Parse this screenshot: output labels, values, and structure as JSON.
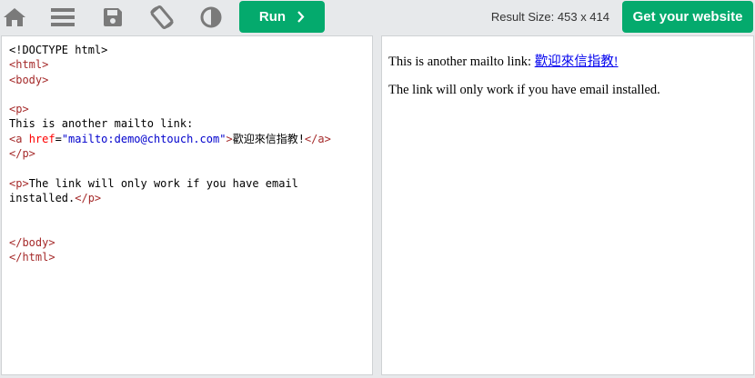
{
  "toolbar": {
    "icons": [
      "home-icon",
      "menu-icon",
      "save-icon",
      "rotate-icon",
      "theme-contrast-icon"
    ],
    "run_label": "Run",
    "result_size_label": "Result Size:",
    "result_size_value": "453 x 414",
    "get_website_label": "Get your website"
  },
  "code": {
    "line_doctype": "<!DOCTYPE html>",
    "line_html_open": "<html>",
    "line_body_open": "<body>",
    "line_p_open": "<p>",
    "line_text": "This is another mailto link:",
    "line_a_open_start": "<a ",
    "line_a_attr": "href",
    "line_a_eq": "=",
    "line_a_attrval": "\"mailto:demo@chtouch.com\"",
    "line_a_gt": ">",
    "line_a_text": "歡迎來信指教!",
    "line_a_close": "</a>",
    "line_p_close": "</p>",
    "line2_p_open": "<p>",
    "line2_text_1": "The link will only work if you have email",
    "line2_text_2": "installed.",
    "line2_p_close": "</p>",
    "line_body_close": "</body>",
    "line_html_close": "</html>"
  },
  "result": {
    "p1_text": "This is another mailto link: ",
    "p1_link": "歡迎來信指教!",
    "p2_text": "The link will only work if you have email installed."
  },
  "colors": {
    "accent": "#04aa6d",
    "tag": "#a52a2a",
    "attr": "#ff0000",
    "attr_value": "#0000cd",
    "link": "#0000ee"
  }
}
